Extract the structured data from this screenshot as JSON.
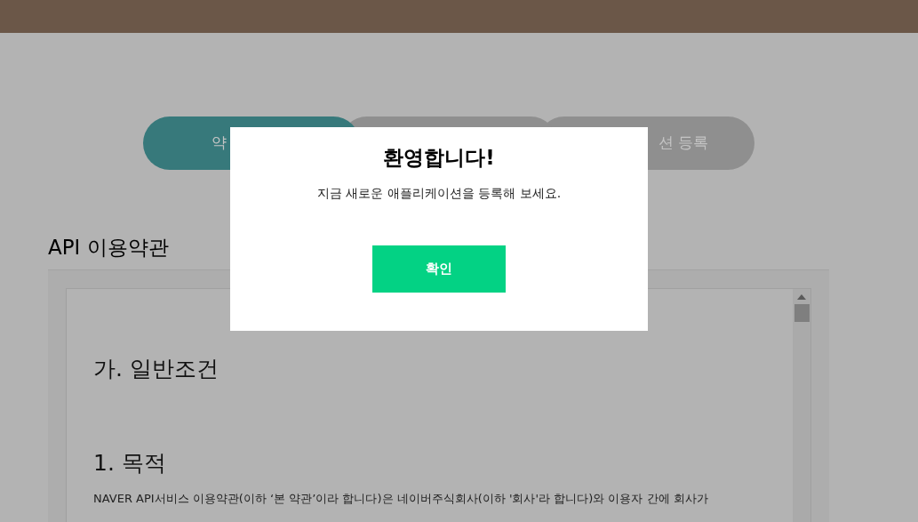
{
  "steps": [
    {
      "label": "약",
      "selected": true
    },
    {
      "selected": false
    },
    {
      "label": "션 등록",
      "selected": false
    }
  ],
  "section_title": "API 이용약관",
  "terms": {
    "heading": "가. 일반조건",
    "subheading": "1. 목적",
    "paragraph": "NAVER API서비스 이용약관(이하 ‘본 약관’이라 합니다)은 네이버주식회사(이하 '회사'라 합니다)와 이용자 간에 회사가"
  },
  "dialog": {
    "title": "환영합니다!",
    "message": "지금 새로운 애플리케이션을 등록해 보세요.",
    "button": "확인"
  }
}
